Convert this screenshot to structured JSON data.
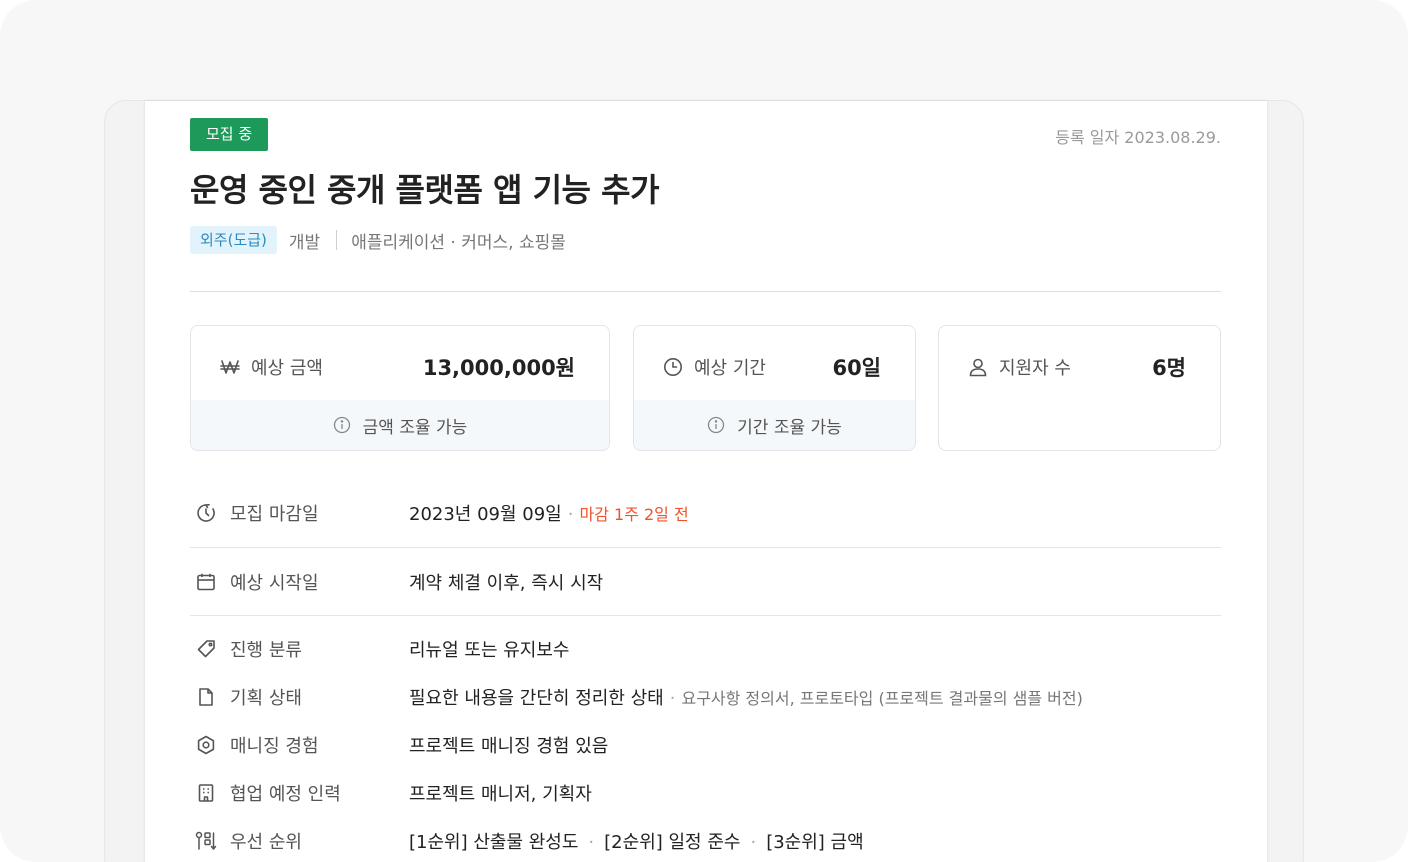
{
  "project": {
    "status": "모집 중",
    "registered": "등록 일자 2023.08.29.",
    "title": "운영 중인 중개 플랫폼 앱 기능 추가",
    "type_tag": "외주(도급)",
    "field": "개발",
    "category": "애플리케이션 · 커머스, 쇼핑몰"
  },
  "summary": {
    "budget": {
      "label": "예상 금액",
      "value": "13,000,000원",
      "note": "금액 조율 가능",
      "icon": "won-icon"
    },
    "period": {
      "label": "예상 기간",
      "value": "60일",
      "note": "기간 조율 가능",
      "icon": "clock-icon"
    },
    "applicants": {
      "label": "지원자 수",
      "value": "6명",
      "icon": "person-icon"
    }
  },
  "details": {
    "deadline": {
      "label": "모집 마감일",
      "value": "2023년 09월 09일",
      "remaining": "마감 1주 2일 전"
    },
    "start": {
      "label": "예상 시작일",
      "value": "계약 체결 이후, 즉시 시작"
    },
    "progress": {
      "label": "진행 분류",
      "value": "리뉴얼 또는 유지보수"
    },
    "planning": {
      "label": "기획 상태",
      "value": "필요한 내용을 간단히 정리한 상태",
      "sub": "요구사항 정의서, 프로토타입 (프로젝트 결과물의 샘플 버전)"
    },
    "managing": {
      "label": "매니징 경험",
      "value": "프로젝트 매니징 경험 있음"
    },
    "collab": {
      "label": "협업 예정 인력",
      "value": "프로젝트 매니저, 기획자"
    },
    "priority": {
      "label": "우선 순위",
      "items": [
        "[1순위] 산출물 완성도",
        "[2순위] 일정 준수",
        "[3순위] 금액"
      ]
    }
  },
  "colors": {
    "status": "#1d9a5a",
    "deadline": "#f0532c",
    "tag_text": "#2a8bc0"
  }
}
